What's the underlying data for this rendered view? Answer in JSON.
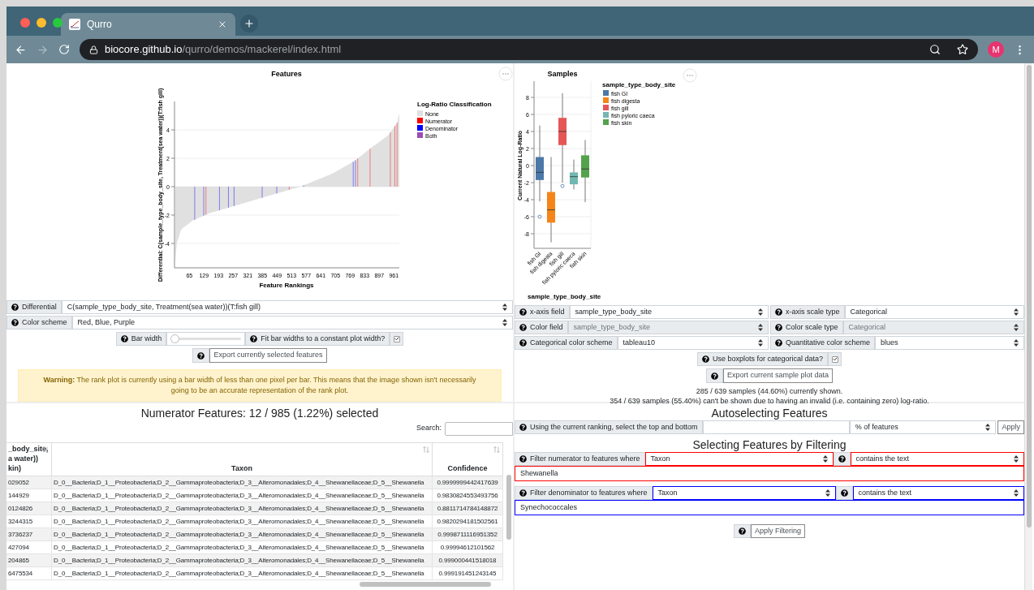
{
  "browser": {
    "tab_title": "Qurro",
    "url_host": "biocore.github.io",
    "url_path": "/qurro/demos/mackerel/index.html",
    "avatar": "M"
  },
  "rank_plot": {
    "title": "Features",
    "ylabel": "Differential: C(sample_type_body_site, Treatment(sea water))(T:fish gill)",
    "xlabel": "Feature Rankings",
    "yticks": [
      "4",
      "2",
      "0",
      "-2",
      "-4"
    ],
    "xticks": [
      "65",
      "129",
      "193",
      "257",
      "321",
      "385",
      "449",
      "513",
      "577",
      "641",
      "705",
      "769",
      "833",
      "897",
      "961"
    ],
    "legend_title": "Log-Ratio Classification",
    "legend": [
      {
        "label": "None",
        "color": "#e0e0e0"
      },
      {
        "label": "Numerator",
        "color": "#ff0000"
      },
      {
        "label": "Denominator",
        "color": "#0000ff"
      },
      {
        "label": "Both",
        "color": "#9b4db3"
      }
    ]
  },
  "rank_controls": {
    "selects": [
      {
        "label": "Differential",
        "value": "C(sample_type_body_site, Treatment(sea water))(T:fish gill)"
      },
      {
        "label": "Color scheme",
        "value": "Red, Blue, Purple"
      }
    ],
    "bar_width": {
      "label": "Bar width",
      "level": 0
    },
    "fit_bar_widths": {
      "label": "Fit bar widths to a constant plot width?",
      "checked": true
    },
    "export_button": "Export currently selected features",
    "warning": "**Warning:** The rank plot is currently using a bar width of less than one pixel per bar. This means that the image shown isn't necessarily going to be an accurate representation of the rank plot."
  },
  "sample_plot": {
    "title": "Samples",
    "ylabel": "Current Natural Log-Ratio",
    "xlabel": "sample_type_body_site",
    "yticks": [
      "8",
      "6",
      "4",
      "2",
      "0",
      "-2",
      "-4",
      "-6",
      "-8"
    ],
    "xticks": [
      "fish GI",
      "fish digesta",
      "fish gill",
      "fish pyloric caeca",
      "fish skin"
    ],
    "legend_title": "sample_type_body_site",
    "legend": [
      {
        "label": "fish GI",
        "color": "#4c78a8"
      },
      {
        "label": "fish digesta",
        "color": "#f58518"
      },
      {
        "label": "fish gill",
        "color": "#e45756"
      },
      {
        "label": "fish pyloric caeca",
        "color": "#72b7b2"
      },
      {
        "label": "fish skin",
        "color": "#54a24b"
      }
    ]
  },
  "sample_controls": {
    "rows": [
      [
        {
          "label": "x-axis field",
          "value": "sample_type_body_site",
          "disabled": false
        },
        {
          "label": "x-axis scale type",
          "value": "Categorical",
          "disabled": false
        }
      ],
      [
        {
          "label": "Color field",
          "value": "sample_type_body_site",
          "disabled": true
        },
        {
          "label": "Color scale type",
          "value": "Categorical",
          "disabled": true
        }
      ],
      [
        {
          "label": "Categorical color scheme",
          "value": "tableau10",
          "disabled": false
        },
        {
          "label": "Quantitative color scheme",
          "value": "blues",
          "disabled": false
        }
      ]
    ],
    "boxplots": {
      "label": "Use boxplots for categorical data?",
      "checked": true
    },
    "export_button": "Export current sample plot data",
    "stats": [
      "285 / 639 samples (44.60%) currently shown.",
      "354 / 639 samples (55.40%) can't be shown due to having an invalid (i.e. containing zero) log-ratio."
    ]
  },
  "numerator_table": {
    "title": "Numerator Features: 12 / 985 (1.22%) selected",
    "search_label": "Search:",
    "columns": [
      {
        "lines": [
          "_body_site,",
          "a water))",
          "kin)"
        ]
      },
      {
        "lines": [
          "Taxon"
        ]
      },
      {
        "lines": [
          "Confidence"
        ]
      }
    ],
    "rows": [
      [
        "029052",
        "D_0__Bacteria;D_1__Proteobacteria;D_2__Gammaproteobacteria;D_3__Alteromonadales;D_4__Shewanellaceae;D_5__Shewanella",
        "0.9999999442417639"
      ],
      [
        "144929",
        "D_0__Bacteria;D_1__Proteobacteria;D_2__Gammaproteobacteria;D_3__Alteromonadales;D_4__Shewanellaceae;D_5__Shewanella",
        "0.9830824553493756"
      ],
      [
        "0124826",
        "D_0__Bacteria;D_1__Proteobacteria;D_2__Gammaproteobacteria;D_3__Alteromonadales;D_4__Shewanellaceae;D_5__Shewanella",
        "0.8811714784148872"
      ],
      [
        "3244315",
        "D_0__Bacteria;D_1__Proteobacteria;D_2__Gammaproteobacteria;D_3__Alteromonadales;D_4__Shewanellaceae;D_5__Shewanella",
        "0.9820294181502561"
      ],
      [
        "3736237",
        "D_0__Bacteria;D_1__Proteobacteria;D_2__Gammaproteobacteria;D_3__Alteromonadales;D_4__Shewanellaceae;D_5__Shewanella",
        "0.9998711116951352"
      ],
      [
        "427094",
        "D_0__Bacteria;D_1__Proteobacteria;D_2__Gammaproteobacteria;D_3__Alteromonadales;D_4__Shewanellaceae;D_5__Shewanella",
        "0.99994612101562"
      ],
      [
        "204865",
        "D_0__Bacteria;D_1__Proteobacteria;D_2__Gammaproteobacteria;D_3__Alteromonadales;D_4__Shewanellaceae;D_5__Shewanella",
        "0.999000441518018"
      ],
      [
        "6475534",
        "D_0__Bacteria;D_1__Proteobacteria;D_2__Gammaproteobacteria;D_3__Alteromonadales;D_4__Shewanellaceae;D_5__Shewanella",
        "0.999191451243145"
      ]
    ]
  },
  "autoselect": {
    "title": "Autoselecting Features",
    "label": "Using the current ranking, select the top and bottom",
    "unit": "% of features",
    "apply": "Apply"
  },
  "filtering": {
    "title": "Selecting Features by Filtering",
    "filters": [
      {
        "kind": "numerator",
        "label": "Filter numerator to features where",
        "field": "Taxon",
        "operator": "contains the text",
        "text": "Shewanella",
        "color": "#ff0000"
      },
      {
        "kind": "denominator",
        "label": "Filter denominator to features where",
        "field": "Taxon",
        "operator": "contains the text",
        "text": "Synechococcales",
        "color": "#0000ff"
      }
    ],
    "apply": "Apply Filtering"
  }
}
